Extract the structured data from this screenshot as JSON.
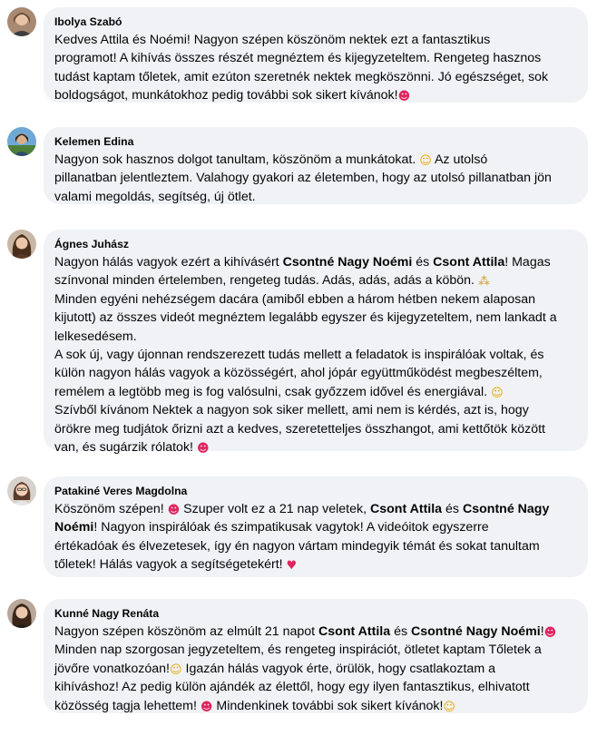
{
  "comments": [
    {
      "author": "Ibolya Szabó",
      "lines": [
        "Kedves Attila és Noémi! Nagyon szépen köszönöm nektek ezt a fantasztikus",
        "programot! A kihívás összes részét megnéztem és kijegyzeteltem. Rengeteg hasznos",
        "tudást kaptam tőletek, amit ezúton szeretnék nektek megköszönni. Jó egészséget, sok",
        "boldogságot, munkátokhoz pedig további sok sikert kívánok!"
      ],
      "emojis": [
        "heart-eyes-face"
      ]
    },
    {
      "author": "Kelemen Edina",
      "lines": [
        "Nagyon sok hasznos dolgot tanultam, köszönöm a munkátokat.",
        "Az utolsó",
        "pillanatban jelentleztem. Valahogy gyakori az életemben, hogy az utolsó pillanatban jön",
        "valami megoldás, segítség, új ötlet."
      ],
      "emojis": [
        "smile-face"
      ]
    },
    {
      "author": "Ágnes Juhász",
      "tags": [
        "Csontné Nagy Noémi",
        "Csont Attila"
      ],
      "lines": [
        "Nagyon hálás vagyok ezért a kihívásért",
        "és",
        "! Magas",
        "színvonal minden értelemben, rengeteg tudás. Adás, adás, adás a köbön.",
        "Minden egyéni nehézségem dacára (amiből ebben a három hétben nekem alaposan",
        "kijutott) az összes videót megnéztem legalább egyszer és kijegyzeteltem, nem lankadt a",
        "lelkesedésem.",
        "A sok új, vagy újonnan rendszerezett tudás mellett a feladatok is inspirálóak voltak, és",
        "külön nagyon hálás vagyok a közösségért, ahol jópár együttműködést megbeszéltem,",
        "remélem a legtöbb meg is fog valósulni, csak győzzem idővel és energiával.",
        "Szívből kívánom Nektek a nagyon sok siker mellett, ami nem is kérdés, azt is, hogy",
        "örökre meg tudjátok őrizni azt a kedves, szeretetteljes összhangot, ami kettőtök között",
        "van, és sugárzik rólatok!"
      ],
      "emojis": [
        "folded-hands",
        "grin-face",
        "heart-eyes-face"
      ]
    },
    {
      "author": "Patakiné Veres Magdolna",
      "tags": [
        "Csont Attila",
        "Csontné Nagy",
        "Noémi"
      ],
      "lines": [
        "Köszönöm szépen!",
        "Szuper volt ez a 21 nap veletek,",
        "és",
        "! Nagyon inspirálóak és szimpatikusak vagytok! A videóitok egyszerre",
        "értékadóak és élvezetesek, így én nagyon vártam mindegyik témát és sokat tanultam",
        "tőletek! Hálás vagyok a segítségetekért!"
      ],
      "emojis": [
        "heart-eyes-face",
        "red-heart"
      ]
    },
    {
      "author": "Kunné Nagy Renáta",
      "tags": [
        "Csont Attila",
        "Csontné Nagy Noémi"
      ],
      "lines": [
        "Nagyon szépen köszönöm az elmúlt 21 napot",
        "és",
        "!",
        "Minden nap szorgosan jegyzeteltem, és rengeteg inspirációt, ötletet kaptam Tőletek a",
        "jövőre vonatkozóan!",
        "Igazán hálás vagyok érte, örülök, hogy csatlakoztam a",
        "kihíváshoz! Az pedig külön ajándék az élettől, hogy egy ilyen fantasztikus, elhivatott",
        "közösség tagja lehettem!",
        "Mindenkinek további sok sikert kívánok!"
      ],
      "emojis": [
        "heart-eyes-face",
        "hugging-face",
        "heart-eyes-face",
        "grin-face"
      ]
    }
  ],
  "colors": {
    "bubble": "#f0f2f5",
    "text": "#050505",
    "background": "#ffffff"
  }
}
